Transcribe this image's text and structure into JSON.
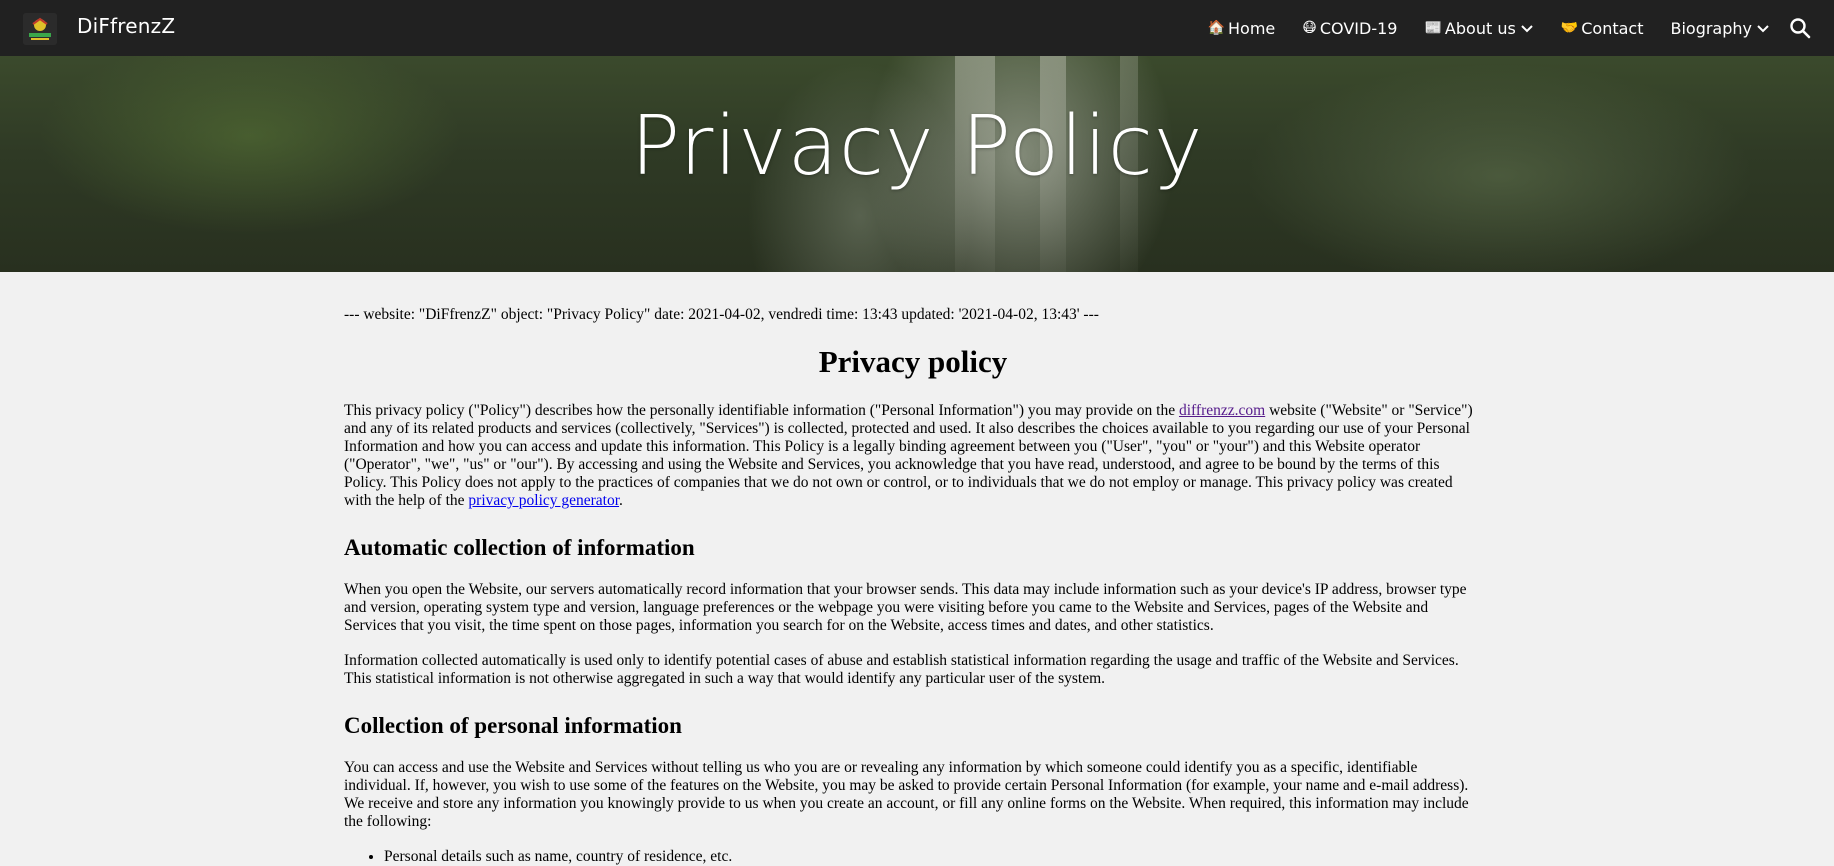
{
  "header": {
    "site_name": "DiFfrenzZ",
    "nav": [
      {
        "emoji": "🏠",
        "label": "Home",
        "dropdown": false
      },
      {
        "emoji": "😷",
        "label": "COVID-19",
        "dropdown": false
      },
      {
        "emoji": "📰",
        "label": "About us",
        "dropdown": true
      },
      {
        "emoji": "🤝",
        "label": "Contact",
        "dropdown": false
      },
      {
        "emoji": "",
        "label": "Biography",
        "dropdown": true
      }
    ],
    "search_icon": "search-icon"
  },
  "hero": {
    "title": "Privacy Policy"
  },
  "content": {
    "meta_line": "--- website: \"DiFfrenzZ\" object: \"Privacy Policy\" date: 2021-04-02, vendredi time: 13:43 updated: '2021-04-02, 13:43' ---",
    "title": "Privacy policy",
    "intro": {
      "part1": "This privacy policy (\"Policy\") describes how the personally identifiable information (\"Personal Information\") you may provide on the ",
      "link1": "diffrenzz.com",
      "part2": " website (\"Website\" or \"Service\") and any of its related products and services (collectively, \"Services\") is collected, protected and used. It also describes the choices available to you regarding our use of your Personal Information and how you can access and update this information. This Policy is a legally binding agreement between you (\"User\", \"you\" or \"your\") and this Website operator (\"Operator\", \"we\", \"us\" or \"our\"). By accessing and using the Website and Services, you acknowledge that you have read, understood, and agree to be bound by the terms of this Policy. This Policy does not apply to the practices of companies that we do not own or control, or to individuals that we do not employ or manage. This privacy policy was created with the help of the ",
      "link2": "privacy policy generator",
      "part3": "."
    },
    "section1": {
      "heading": "Automatic collection of information",
      "p1": "When you open the Website, our servers automatically record information that your browser sends. This data may include information such as your device's IP address, browser type and version, operating system type and version, language preferences or the webpage you were visiting before you came to the Website and Services, pages of the Website and Services that you visit, the time spent on those pages, information you search for on the Website, access times and dates, and other statistics.",
      "p2": "Information collected automatically is used only to identify potential cases of abuse and establish statistical information regarding the usage and traffic of the Website and Services. This statistical information is not otherwise aggregated in such a way that would identify any particular user of the system."
    },
    "section2": {
      "heading": "Collection of personal information",
      "p1": "You can access and use the Website and Services without telling us who you are or revealing any information by which someone could identify you as a specific, identifiable individual. If, however, you wish to use some of the features on the Website, you may be asked to provide certain Personal Information (for example, your name and e-mail address). We receive and store any information you knowingly provide to us when you create an account, or fill any online forms on the Website. When required, this information may include the following:",
      "bullets": [
        "Personal details such as name, country of residence, etc."
      ]
    }
  }
}
